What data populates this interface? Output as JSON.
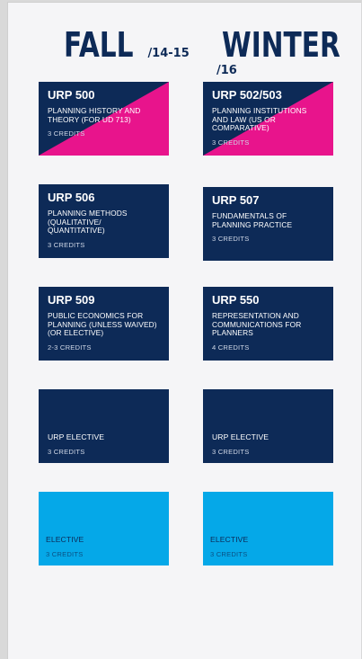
{
  "columns": {
    "fall": {
      "label": "FALL",
      "suffix": "/14-15"
    },
    "winter": {
      "label": "WINTER",
      "suffix": "/16"
    }
  },
  "colors": {
    "navy": "#0d2a57",
    "magenta": "#e8148c",
    "cyan": "#05a8e8",
    "background": "#f5f5f7"
  },
  "fall_courses": [
    {
      "code": "URP 500",
      "title": "PLANNING HISTORY AND THEORY (FOR UD 713)",
      "credits": "3 CREDITS"
    },
    {
      "code": "URP 506",
      "title": "PLANNING METHODS (QUALITATIVE/ QUANTITATIVE)",
      "credits": "3 CREDITS"
    },
    {
      "code": "URP 509",
      "title": "PUBLIC ECONOMICS FOR PLANNING (UNLESS WAIVED) (OR ELECTIVE)",
      "credits": "2-3 CREDITS"
    },
    {
      "title": "URP ELECTIVE",
      "credits": "3 CREDITS"
    },
    {
      "title": "ELECTIVE",
      "credits": "3 CREDITS"
    }
  ],
  "winter_courses": [
    {
      "code": "URP 502/503",
      "title": "PLANNING INSTITUTIONS AND LAW (US OR COMPARATIVE)",
      "credits": "3 CREDITS"
    },
    {
      "code": "URP 507",
      "title": "FUNDAMENTALS OF PLANNING PRACTICE",
      "credits": "3 CREDITS"
    },
    {
      "code": "URP 550",
      "title": "REPRESENTATION AND COMMUNICATIONS FOR PLANNERS",
      "credits": "4 CREDITS"
    },
    {
      "title": "URP ELECTIVE",
      "credits": "3 CREDITS"
    },
    {
      "title": "ELECTIVE",
      "credits": "3 CREDITS"
    }
  ]
}
